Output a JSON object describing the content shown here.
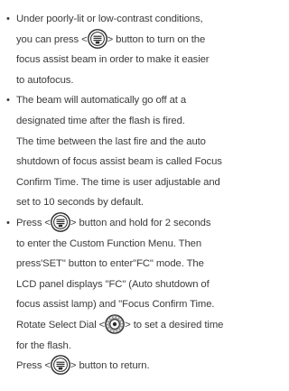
{
  "bullet_char": "•",
  "items": [
    {
      "lines": [
        {
          "text": "Under poorly-lit or low-contrast conditions,"
        },
        {
          "before": "you can press <",
          "icon": "fn-button-icon",
          "after": "> button to turn on the"
        },
        {
          "text": "focus assist beam in order to make it easier"
        },
        {
          "text": "to autofocus."
        }
      ]
    },
    {
      "lines": [
        {
          "text": "The beam will automatically go off at a"
        },
        {
          "text": "designated time after the flash is fired."
        },
        {
          "text": "The time between the last fire and the auto"
        },
        {
          "text": "shutdown of focus assist beam is called Focus"
        },
        {
          "text": "Confirm Time. The time is user adjustable and"
        },
        {
          "text": "set to 10 seconds by default."
        }
      ]
    },
    {
      "lines": [
        {
          "before": "Press <",
          "icon": "fn-button-icon",
          "after": "> button and hold for 2 seconds"
        },
        {
          "text": "to enter the Custom Function Menu. Then"
        },
        {
          "text": "press'SET\" button to enter\"FC\" mode. The"
        },
        {
          "text": "LCD panel displays \"FC\" (Auto shutdown of"
        },
        {
          "text": "focus assist lamp) and \"Focus Confirm Time."
        },
        {
          "before": "Rotate Select Dial <",
          "icon": "select-dial-icon",
          "after": "> to set a desired time"
        },
        {
          "text": "for the flash."
        },
        {
          "before": "Press <",
          "icon": "fn-button-icon",
          "after": "> button to return."
        }
      ]
    }
  ]
}
